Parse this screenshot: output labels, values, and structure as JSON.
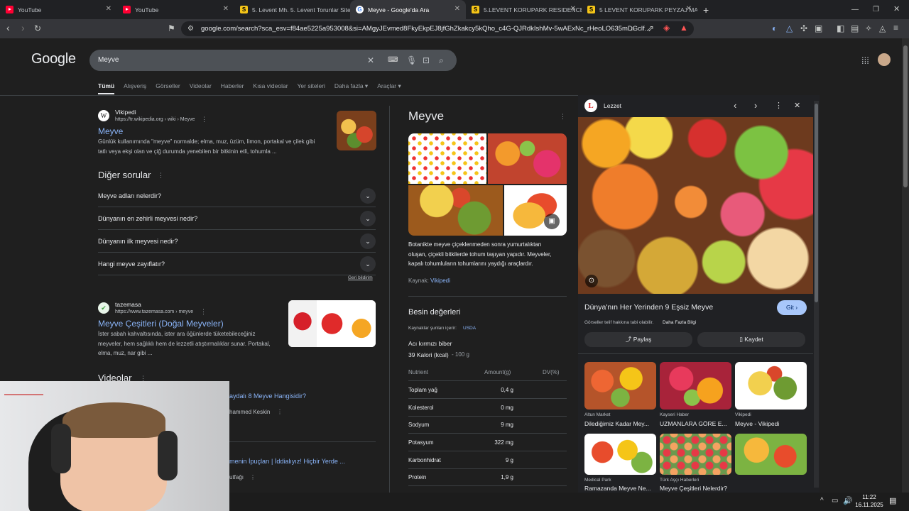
{
  "tabs": [
    {
      "label": "YouTube",
      "icon": "youtube-icon"
    },
    {
      "label": "YouTube",
      "icon": "youtube-icon"
    },
    {
      "label": "5. Levent Mh. 5. Levent Torunlar Sitesi",
      "icon": "s-icon"
    },
    {
      "label": "Meyve - Google'da Ara",
      "icon": "google-icon",
      "active": true
    },
    {
      "label": "5.LEVENT KORUPARK RESIDENCEDE",
      "icon": "s-icon"
    },
    {
      "label": "5 LEVENT KORUPARK PEYZAJ MANZ",
      "icon": "s-icon"
    }
  ],
  "url": "google.com/search?sca_esv=f84ae5225a953008&si=AMgyJEvmed8FkyEkpEJ8jfGhZkakcy5kQho_c4G-QJRdkIshMv-5wAExNc_rHeoLO635mDGclf...",
  "logo": "Google",
  "search": {
    "query": "Meyve"
  },
  "nav": [
    "Tümü",
    "Alışveriş",
    "Görseller",
    "Videolar",
    "Haberler",
    "Kısa videolar",
    "Yer siteleri",
    "Daha fazla",
    "Araçlar"
  ],
  "result1": {
    "site": "Vikipedi",
    "url": "https://tr.wikipedia.org › wiki › Meyve",
    "title": "Meyve",
    "snippet1": "Günlük kullanımında \"meyve\" normalde; elma, muz, üzüm, limon, portakal ve çilek gibi",
    "snippet2": "tatlı veya ekşi olan ve çiğ durumda yenebilen bir bitkinin etli, tohumla ..."
  },
  "paa": {
    "title": "Diğer sorular",
    "questions": [
      "Meyve adları nelerdir?",
      "Dünyanın en zehirli meyvesi nedir?",
      "Dünyanın ilk meyvesi nedir?",
      "Hangi meyve zayıflatır?"
    ],
    "feedback": "Geri bildirim"
  },
  "result2": {
    "site": "tazemasa",
    "url": "https://www.tazemasa.com › meyve",
    "title": "Meyve Çeşitleri (Doğal Meyveler)",
    "snippet1": "İster sabah kahvaltısında, ister ara öğünlerde tüketebileceğiniz",
    "snippet2": "meyveler, hem sağlıklı hem de lezzetli atıştırmalıklar sunar. Portakal,",
    "snippet3": "elma, muz, nar gibi ..."
  },
  "videos": {
    "title": "Videolar",
    "v1_title": "aydalı 8 Meyve Hangisidir?",
    "v1_author": "hammed Keskin",
    "v2_title": "menin İpuçları | İddialıyız! Hiçbir Yerde ...",
    "v2_author": "utfağı"
  },
  "kp": {
    "title": "Meyve",
    "desc1": "Botanikte meyve çiçeklenmeden sonra yumurtalıktan",
    "desc2": "oluşan, çiçekli bitkilerde tohum taşıyan yapıdır. Meyveler,",
    "desc3": "kapalı tohumluların tohumlarını yaydığı araçlardır.",
    "source_label": "Kaynak:",
    "source": "Vikipedi",
    "nut_title": "Besin değerleri",
    "nut_source_label": "Kaynaklar şunları içerir:",
    "nut_source": "USDA",
    "item": "Acı kırmızı biber",
    "cal": "39 Kalori (kcal)",
    "cal_unit": "- 100 g",
    "cols": [
      "Nutrient",
      "Amount(g)",
      "DV(%)"
    ],
    "rows": [
      [
        "Toplam yağ",
        "0,4 g"
      ],
      [
        "Kolesterol",
        "0 mg"
      ],
      [
        "Sodyum",
        "9 mg"
      ],
      [
        "Potasyum",
        "322 mg"
      ],
      [
        "Karbonhidrat",
        "9 g"
      ],
      [
        "Protein",
        "1,9 g"
      ]
    ]
  },
  "panel": {
    "source": "Lezzet",
    "title": "Dünya'nın Her Yerinden 9 Eşsiz Meyve",
    "go": "Git",
    "copyright": "Görseller telif hakkına tabi olabilir.",
    "more": "Daha Fazla Bilgi",
    "share": "Paylaş",
    "save": "Kaydet",
    "items": [
      {
        "src": "Altun Market",
        "cap": "Dilediğimiz Kadar Mey..."
      },
      {
        "src": "Kayseri Haber",
        "cap": "UZMANLARA GÖRE E..."
      },
      {
        "src": "Vikipedi",
        "cap": "Meyve - Vikipedi"
      },
      {
        "src": "Medical Park",
        "cap": "Ramazanda Meyve Ne..."
      },
      {
        "src": "Türk Aşçı Haberleri",
        "cap": "Meyve Çeşitleri Nelerdir?"
      },
      {
        "src": "",
        "cap": ""
      }
    ]
  },
  "clock": {
    "time": "11:22",
    "date": "16.11.2025"
  }
}
